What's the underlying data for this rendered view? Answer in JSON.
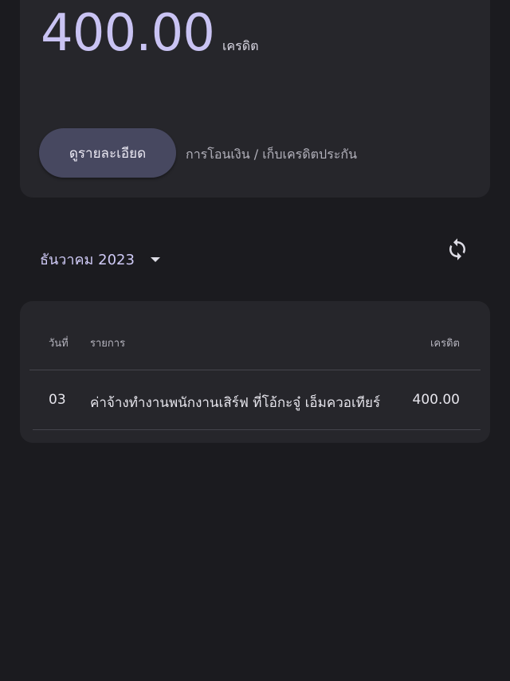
{
  "balance": {
    "amount": "400.00",
    "unit": "เครดิต"
  },
  "actions": {
    "details_label": "ดูรายละเอียด",
    "details_hint": "การโอนเงิน / เก็บเครดิตประกัน"
  },
  "filter": {
    "month_label": "ธันวาคม 2023",
    "refresh_icon": "refresh-icon"
  },
  "table": {
    "headers": {
      "day": "วันที่",
      "description": "รายการ",
      "credit": "เครดิต"
    },
    "rows": [
      {
        "day": "03",
        "description": "ค่าจ้างทำงานพนักงานเสิร์ฟ ที่โอ้กะจู๋ เอ็มควอเทียร์",
        "credit": "400.00"
      }
    ]
  },
  "colors": {
    "background": "#1b1b1f",
    "card": "#26262b",
    "accent": "#c9c3f3",
    "button": "#474860"
  }
}
